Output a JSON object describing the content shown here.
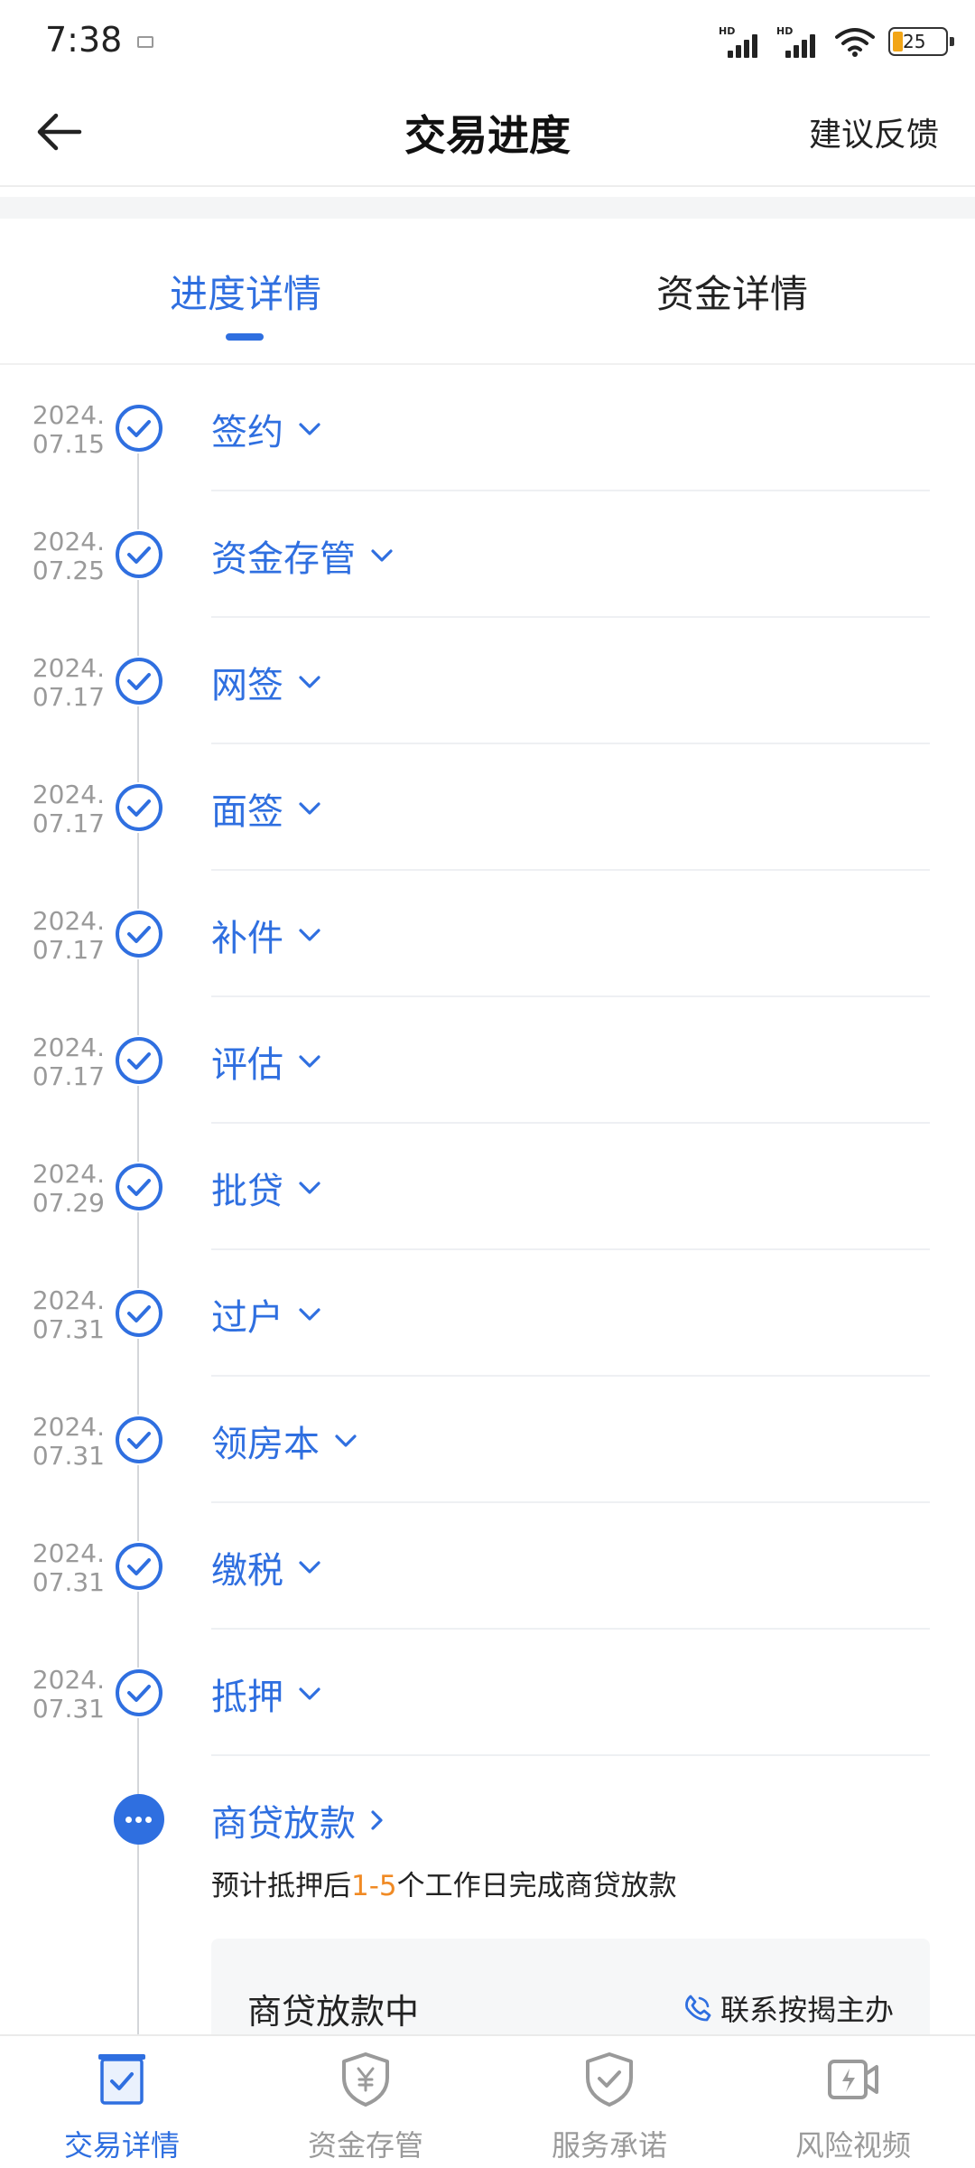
{
  "status_bar": {
    "time": "7:38",
    "signal_label_1": "HD",
    "signal_label_2": "HD",
    "battery_level": "25"
  },
  "header": {
    "title": "交易进度",
    "feedback_label": "建议反馈"
  },
  "tabs": [
    {
      "label": "进度详情",
      "active": true
    },
    {
      "label": "资金详情",
      "active": false
    }
  ],
  "timeline": {
    "steps": [
      {
        "date_year": "2024.",
        "date_md": "07.15",
        "name": "签约",
        "status": "done"
      },
      {
        "date_year": "2024.",
        "date_md": "07.25",
        "name": "资金存管",
        "status": "done"
      },
      {
        "date_year": "2024.",
        "date_md": "07.17",
        "name": "网签",
        "status": "done"
      },
      {
        "date_year": "2024.",
        "date_md": "07.17",
        "name": "面签",
        "status": "done"
      },
      {
        "date_year": "2024.",
        "date_md": "07.17",
        "name": "补件",
        "status": "done"
      },
      {
        "date_year": "2024.",
        "date_md": "07.17",
        "name": "评估",
        "status": "done"
      },
      {
        "date_year": "2024.",
        "date_md": "07.29",
        "name": "批贷",
        "status": "done"
      },
      {
        "date_year": "2024.",
        "date_md": "07.31",
        "name": "过户",
        "status": "done"
      },
      {
        "date_year": "2024.",
        "date_md": "07.31",
        "name": "领房本",
        "status": "done"
      },
      {
        "date_year": "2024.",
        "date_md": "07.31",
        "name": "缴税",
        "status": "done"
      },
      {
        "date_year": "2024.",
        "date_md": "07.31",
        "name": "抵押",
        "status": "done"
      }
    ],
    "current": {
      "name": "商贷放款",
      "note_prefix": "预计抵押后",
      "note_highlight": "1-5",
      "note_suffix": "个工作日完成商贷放款",
      "card_status": "商贷放款中",
      "contact_label": "联系按揭主办"
    }
  },
  "bottom_nav": [
    {
      "label": "交易详情",
      "icon": "clipboard-check-icon",
      "active": true
    },
    {
      "label": "资金存管",
      "icon": "shield-yen-icon",
      "active": false
    },
    {
      "label": "服务承诺",
      "icon": "shield-check-icon",
      "active": false
    },
    {
      "label": "风险视频",
      "icon": "video-lightning-icon",
      "active": false
    }
  ],
  "colors": {
    "accent": "#2f6fe0",
    "highlight": "#f08a24",
    "muted": "#9a9a9a"
  }
}
